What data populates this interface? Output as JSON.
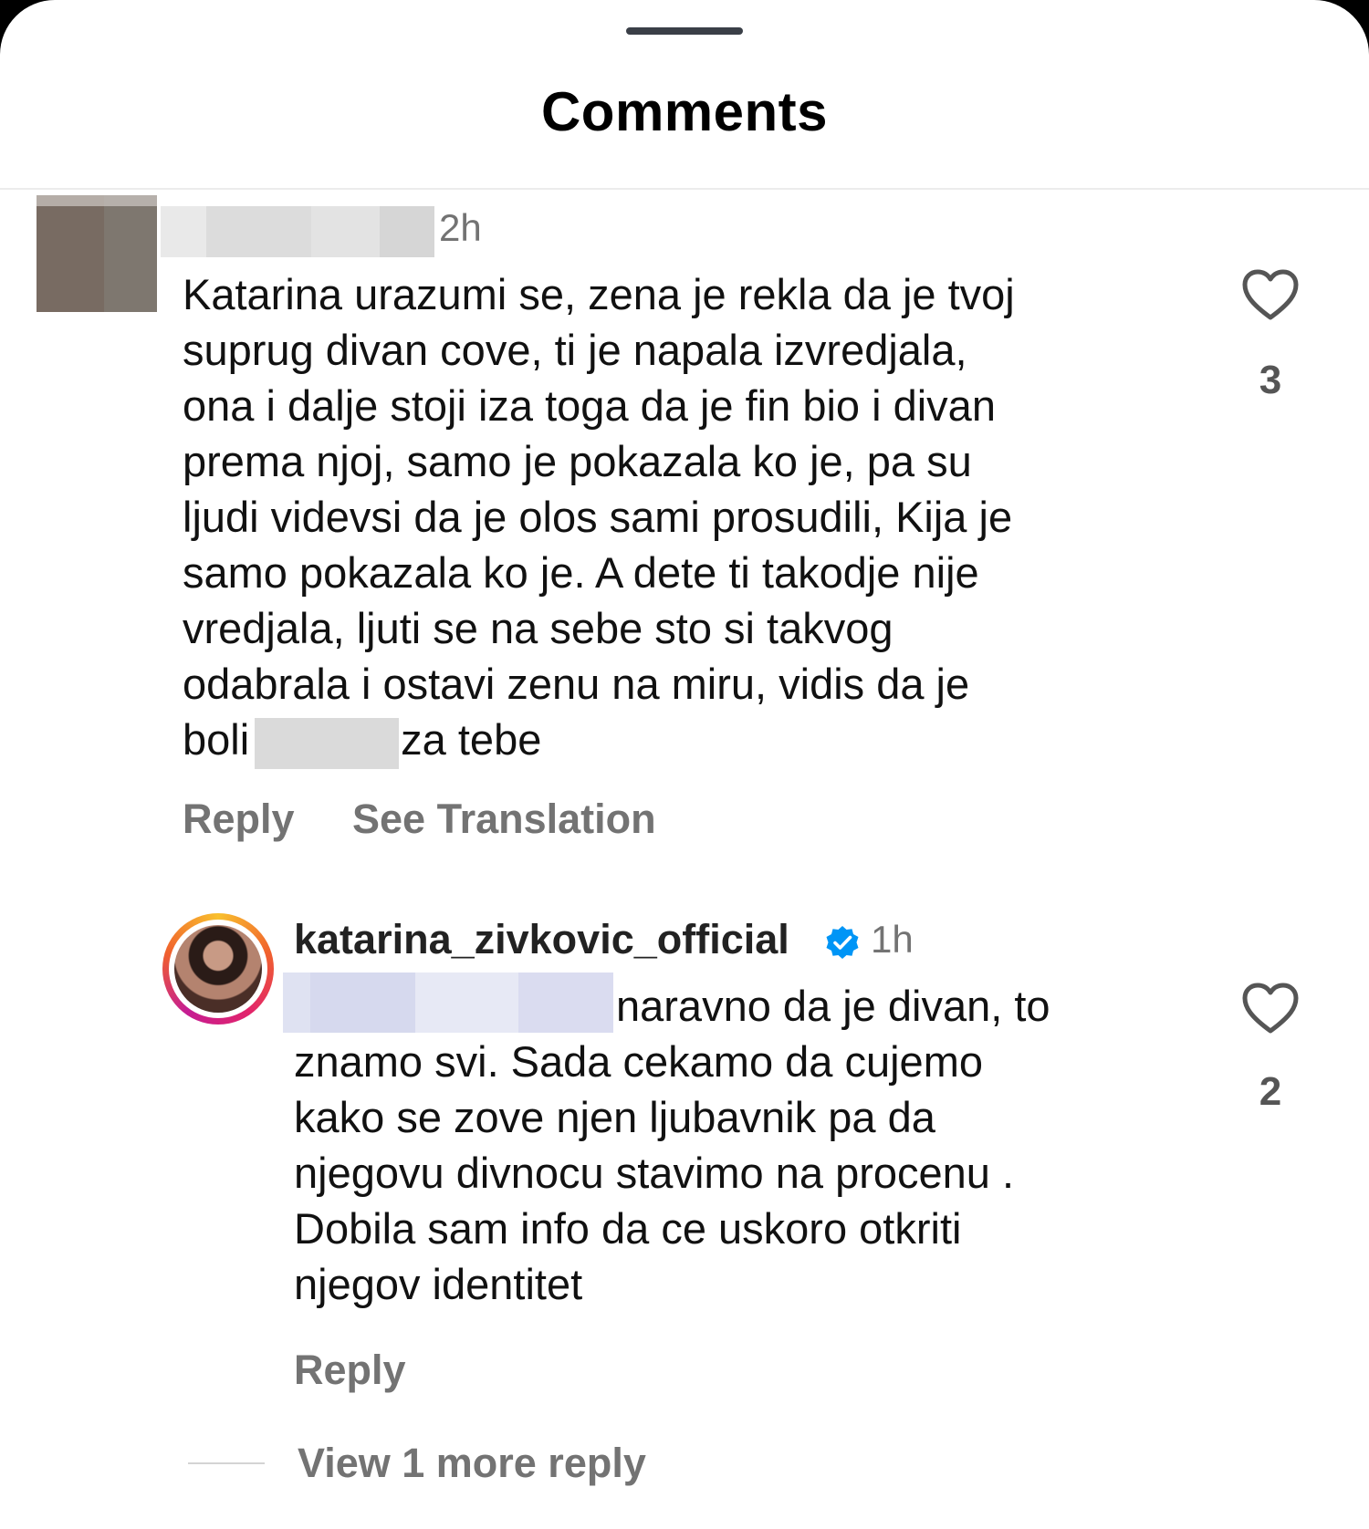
{
  "header": {
    "title": "Comments"
  },
  "comments": [
    {
      "time": "2h",
      "lines": [
        "Katarina urazumi se, zena je rekla da je tvoj",
        "suprug divan cove, ti je napala izvredjala,",
        "ona i dalje stoji iza toga da je fin bio i divan",
        "prema njoj, samo je pokazala ko je, pa su",
        "ljudi videvsi da je olos sami prosudili, Kija je",
        "samo pokazala ko je. A dete ti takodje nije",
        "vredjala, ljuti se na sebe sto si takvog",
        "odabrala i ostavi zenu na miru, vidis da je"
      ],
      "last_line_start": "boli",
      "last_line_end": "za tebe",
      "likes": "3",
      "reply_label": "Reply",
      "translate_label": "See Translation"
    }
  ],
  "reply": {
    "username": "katarina_zivkovic_official",
    "time": "1h",
    "lines": [
      "naravno da je divan, to",
      "znamo svi. Sada cekamo da cujemo",
      "kako se zove njen ljubavnik pa da",
      "njegovu divnocu stavimo na procenu .",
      "Dobila sam info da ce uskoro otkriti",
      "njegov identitet"
    ],
    "likes": "2",
    "reply_label": "Reply"
  },
  "view_more": "View 1 more reply",
  "colors": {
    "verified": "#0095f6",
    "secondary_text": "#737373"
  },
  "icons": [
    "heart-icon",
    "verified-badge-icon"
  ]
}
